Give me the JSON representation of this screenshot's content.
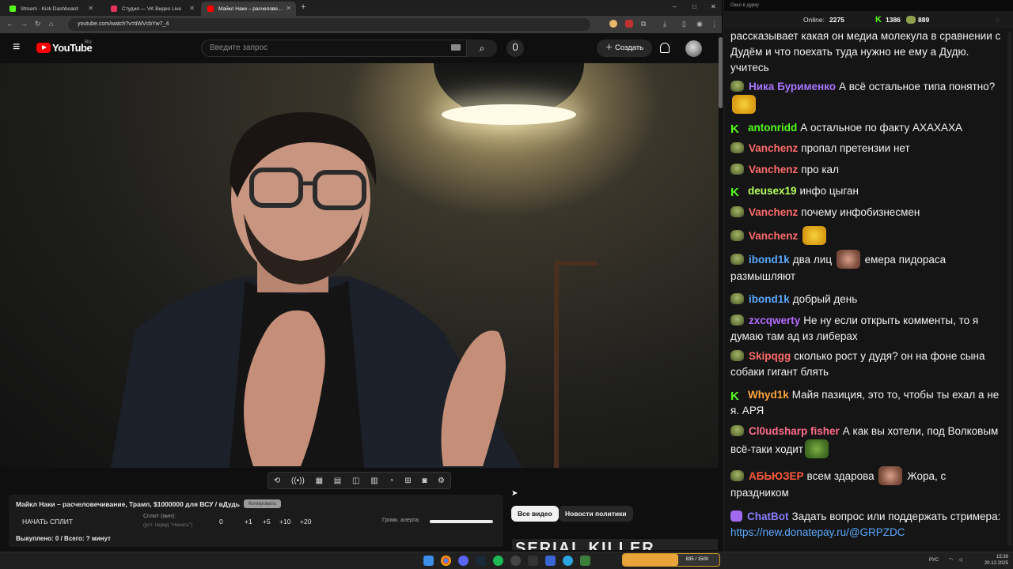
{
  "browser": {
    "tabs": [
      {
        "title": "Stream - Kick Dashboard",
        "active": false,
        "color": "#53fc18"
      },
      {
        "title": "Студия — VK Видео Live",
        "active": false,
        "color": "#e5335b"
      },
      {
        "title": "Майкл Наки – расчелове...",
        "active": true,
        "color": "#ff0000"
      }
    ],
    "new_tab": "+",
    "url": "youtube.com/watch?v=tiWVcbYw7_4",
    "nav_icons": [
      "back-icon",
      "forward-icon",
      "reload-icon",
      "home-icon"
    ],
    "window_controls": [
      "–",
      "□",
      "✕"
    ]
  },
  "youtube": {
    "logo_text": "YouTube",
    "region": "RU",
    "search_placeholder": "Введите запрос",
    "create_label": "Создать",
    "menu_icon": "≡",
    "search_icon": "⌕",
    "mic_icon": "🎙",
    "bell_icon": "🔔"
  },
  "toolbar_icons": [
    "⟲",
    "((•))",
    "▦",
    "▤",
    "◫",
    "▥",
    "◔",
    "⊞",
    "◙",
    "⚙"
  ],
  "panel": {
    "title": "Майкл Наки – расчеловечивание, Трамп, $1000000 для ВСУ / вДудь",
    "copy_label": "Копировать",
    "start_split": "НАЧАТЬ СПЛИТ",
    "split_label": "Сплит (мин):",
    "split_hint": "(уст. перед \"Начать\")",
    "split_value": "0",
    "increments": [
      "+1",
      "+5",
      "+10",
      "+20"
    ],
    "alert_volume_label": "Громк. алерта:",
    "alert_volume": 0.95,
    "bought_status": "Выкуплено: 0 / Всего: ? минут"
  },
  "below_video": {
    "chip_all": "Все видео",
    "chip_news": "Новости политики",
    "thumb_text": "SERIAL   KILLER"
  },
  "chat": {
    "window_title": "Окно в дурку",
    "online_label": "Online:",
    "online_count": "2275",
    "kick_count": "1386",
    "pepe_count": "889",
    "messages": [
      {
        "user": "",
        "badge": "none",
        "text": "рассказывает какая он медиа молекула в сравнении с Дудём и что поехать туда нужно не ему а Дудю. учитесь",
        "color": "#ffffff"
      },
      {
        "user": "Ника Бурименко",
        "badge": "pepe",
        "text": "А всё остальное типа понятно?",
        "color": "#a875ff",
        "emote": "laugh"
      },
      {
        "user": "antonridd",
        "badge": "kick",
        "text": "А остальное по факту АХАХАХА",
        "color": "#53fc18"
      },
      {
        "user": "Vanchenz",
        "badge": "pepe",
        "text": "пропал претензии нет",
        "color": "#ff6b6b"
      },
      {
        "user": "Vanchenz",
        "badge": "pepe",
        "text": "про кал",
        "color": "#ff6b6b"
      },
      {
        "user": "deusex19",
        "badge": "kick",
        "text": "инфо цыган",
        "color": "#b6ff5a"
      },
      {
        "user": "Vanchenz",
        "badge": "pepe",
        "text": "почему инфобизнесмен",
        "color": "#ff6b6b"
      },
      {
        "user": "Vanchenz",
        "badge": "pepe",
        "text": "",
        "color": "#ff6b6b",
        "emote": "laugh"
      },
      {
        "user": "ibond1k",
        "badge": "pepe",
        "text": "два лиц [emote] емера пидораса размышляют",
        "color": "#5aa9ff"
      },
      {
        "user": "ibond1k",
        "badge": "pepe",
        "text": "добрый день",
        "color": "#5aa9ff"
      },
      {
        "user": "zxcqwerty",
        "badge": "pepe",
        "text": "Не ну если открыть комменты, то я думаю там ад из либерах",
        "color": "#b36bff"
      },
      {
        "user": "Skipqgg",
        "badge": "pepe",
        "text": "сколько рост у дудя? он на фоне сына собаки гигант блять",
        "color": "#ff6b6b"
      },
      {
        "user": "Whyd1k",
        "badge": "kick",
        "text": "Майя пазиция, это то, чтобы ты ехал а не я. АРЯ",
        "color": "#ffa53a"
      },
      {
        "user": "Cl0udsharp fisher",
        "badge": "pepe",
        "text": "А как вы хотели, под Волковым всё-таки ходит",
        "color": "#ff6b8a",
        "emote": "frog"
      },
      {
        "user": "АБЬЮЗЕР",
        "badge": "pepe",
        "text": "всем здарова [emote] Жора, с праздником",
        "color": "#ff5a3a"
      },
      {
        "user": "ChatBot",
        "badge": "bot",
        "text": "Задать вопрос или поддержать стримера: https://new.donatepay.ru/@GRPZDC",
        "color": "#8a7dff"
      }
    ]
  },
  "taskbar": {
    "lang": "РУС",
    "time": "15:39",
    "date": "20.12.2025",
    "widget_text": "835 / 1500"
  },
  "colors": {
    "kick_green": "#53fc18",
    "yt_red": "#ff0000",
    "chat_bg": "#151515",
    "link": "#5aa9ff"
  }
}
